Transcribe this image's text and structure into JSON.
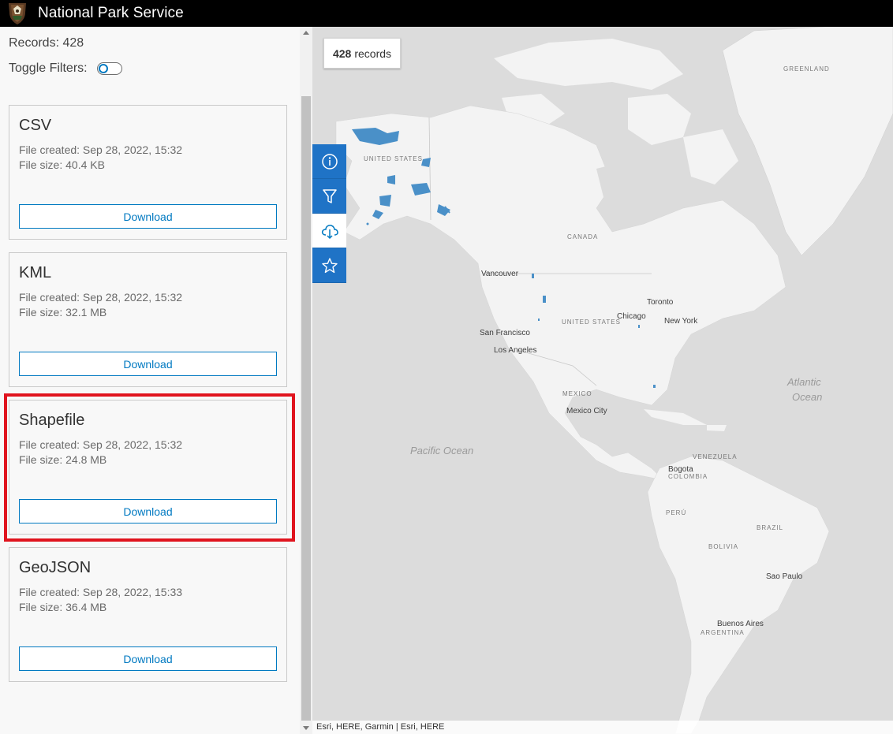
{
  "header": {
    "title": "National Park Service",
    "logo_icon": "arrowhead-logo-icon"
  },
  "sidebar": {
    "records_text": "Records: 428",
    "toggle_label": "Toggle Filters:",
    "toggle_on": false,
    "cards": [
      {
        "title": "CSV",
        "created": "File created: Sep 28, 2022, 15:32",
        "size": "File size: 40.4 KB",
        "button": "Download"
      },
      {
        "title": "KML",
        "created": "File created: Sep 28, 2022, 15:32",
        "size": "File size: 32.1 MB",
        "button": "Download"
      },
      {
        "title": "Shapefile",
        "created": "File created: Sep 28, 2022, 15:32",
        "size": "File size: 24.8 MB",
        "button": "Download"
      },
      {
        "title": "GeoJSON",
        "created": "File created: Sep 28, 2022, 15:33",
        "size": "File size: 36.4 MB",
        "button": "Download"
      }
    ],
    "highlighted_card": "Shapefile"
  },
  "map": {
    "badge_count": "428",
    "badge_suffix": "records",
    "tools": [
      {
        "icon": "info-icon",
        "active": false
      },
      {
        "icon": "filter-icon",
        "active": false
      },
      {
        "icon": "cloud-download-icon",
        "active": true
      },
      {
        "icon": "star-icon",
        "active": false
      }
    ],
    "labels": {
      "greenland": "GREENLAND",
      "united_states_ak": "UNITED STATES",
      "canada": "CANADA",
      "vancouver": "Vancouver",
      "toronto": "Toronto",
      "chicago": "Chicago",
      "united_states": "UNITED STATES",
      "new_york": "New York",
      "san_francisco": "San Francisco",
      "los_angeles": "Los Angeles",
      "mexico": "MEXICO",
      "mexico_city": "Mexico City",
      "atlantic_1": "Atlantic",
      "atlantic_2": "Ocean",
      "pacific": "Pacific Ocean",
      "venezuela": "VENEZUELA",
      "bogota": "Bogota",
      "colombia": "COLOMBIA",
      "peru": "PERÚ",
      "brazil": "BRAZIL",
      "bolivia": "BOLIVIA",
      "sao_paulo": "Sao Paulo",
      "buenos_aires": "Buenos Aires",
      "argentina": "ARGENTINA"
    },
    "attribution": "Esri, HERE, Garmin | Esri, HERE",
    "colors": {
      "land": "#f3f3f3",
      "water": "#dcdcdc",
      "parks": "#4a90c8",
      "tool_bg": "#1f73c6"
    }
  }
}
